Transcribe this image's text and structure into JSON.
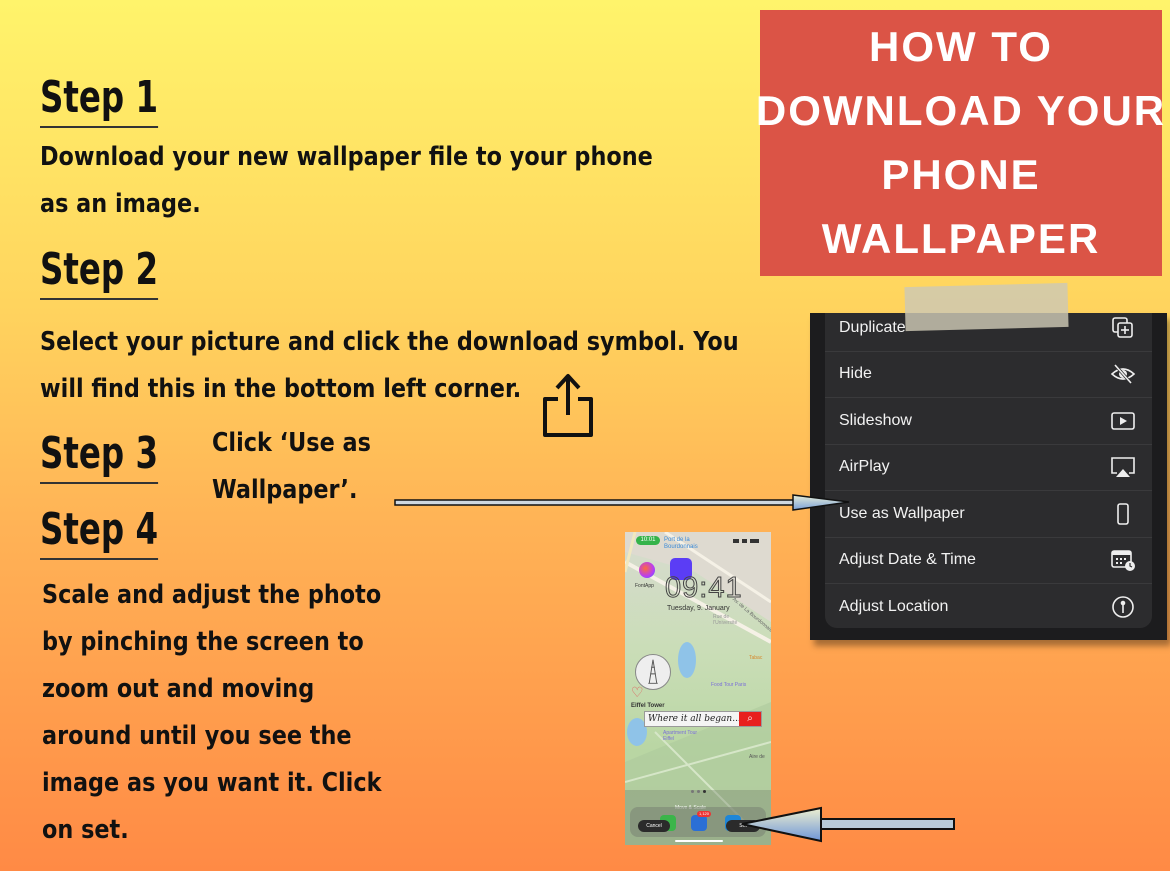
{
  "title": {
    "lines": [
      "HOW TO",
      "DOWNLOAD YOUR",
      "PHONE",
      "WALLPAPER"
    ],
    "background_color": "#db5446",
    "text_color": "#ffffff"
  },
  "steps": [
    {
      "heading": "Step 1",
      "text_lines": [
        "Download your new wallpaper file to your phone",
        "as an image."
      ]
    },
    {
      "heading": "Step 2",
      "text_lines": [
        "Select your picture and click the download symbol. You",
        "will find this in the bottom left corner."
      ]
    },
    {
      "heading": "Step 3",
      "text_lines": [
        "Click ‘Use as",
        "Wallpaper’."
      ]
    },
    {
      "heading": "Step 4",
      "text_lines": [
        "Scale and adjust the photo",
        "by pinching the screen to",
        "zoom out and moving",
        "around until you see the",
        "image as you want it. Click",
        "on set."
      ]
    }
  ],
  "share_icon": "share-upload-icon",
  "menu": {
    "items": [
      {
        "label": "Duplicate",
        "icon": "duplicate-icon"
      },
      {
        "label": "Hide",
        "icon": "eye-slash-icon"
      },
      {
        "label": "Slideshow",
        "icon": "play-icon"
      },
      {
        "label": "AirPlay",
        "icon": "airplay-icon"
      },
      {
        "label": "Use as Wallpaper",
        "icon": "phone-icon"
      },
      {
        "label": "Adjust Date & Time",
        "icon": "calendar-clock-icon"
      },
      {
        "label": "Adjust Location",
        "icon": "location-pin-icon"
      }
    ]
  },
  "phone": {
    "status_time": "10:01",
    "location_label": "Port de la Bourdonnais",
    "app_label": "FontApp",
    "clock": "09:41",
    "date": "Tuesday, 9. January",
    "street_label": "Av. de La Bourdonnais",
    "rue_label": "Rue de l'Université",
    "tabac_label": "Tabac",
    "food_label": "Food Tour Paris",
    "eiffel_label": "Eiffel Tower",
    "banner_text": "Where it all began...",
    "apartment_label": "Apartment Tour Eiffel",
    "airb_label": "Aire de",
    "move_scale": "Move & Scale",
    "cancel_label": "Cancel",
    "set_label": "Set",
    "badge": "1,120"
  },
  "colors": {
    "background_top": "#fff46b",
    "background_bottom": "#ff8a45",
    "menu_bg": "#2c2c2e",
    "banner_search": "#e8201e"
  }
}
